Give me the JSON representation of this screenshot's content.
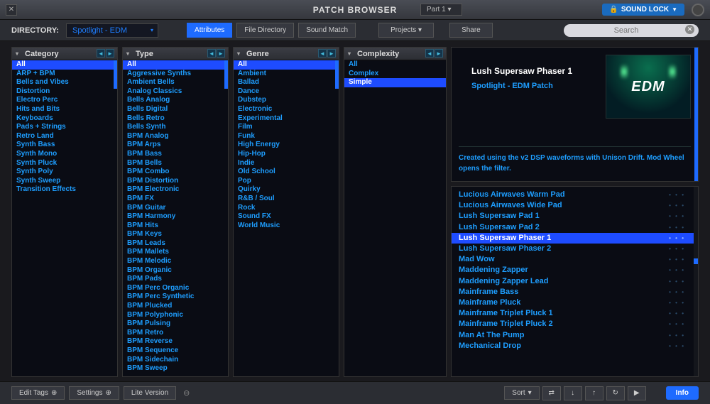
{
  "titlebar": {
    "title": "PATCH BROWSER",
    "part": "Part 1",
    "sound_lock": "SOUND LOCK"
  },
  "toolbar": {
    "directory_label": "DIRECTORY:",
    "directory_value": "Spotlight - EDM",
    "view_attributes": "Attributes",
    "view_file": "File Directory",
    "view_match": "Sound Match",
    "projects": "Projects",
    "share": "Share",
    "search_placeholder": "Search"
  },
  "columns": {
    "category": {
      "header": "Category",
      "items": [
        "All",
        "ARP + BPM",
        "Bells and Vibes",
        "Distortion",
        "Electro Perc",
        "Hits and Bits",
        "Keyboards",
        "Pads + Strings",
        "Retro Land",
        "Synth Bass",
        "Synth Mono",
        "Synth Pluck",
        "Synth Poly",
        "Synth Sweep",
        "Transition Effects"
      ],
      "selected": 0
    },
    "type": {
      "header": "Type",
      "items": [
        "All",
        "Aggressive Synths",
        "Ambient Bells",
        "Analog Classics",
        "Bells Analog",
        "Bells Digital",
        "Bells Retro",
        "Bells Synth",
        "BPM Analog",
        "BPM Arps",
        "BPM Bass",
        "BPM Bells",
        "BPM Combo",
        "BPM Distortion",
        "BPM Electronic",
        "BPM FX",
        "BPM Guitar",
        "BPM Harmony",
        "BPM Hits",
        "BPM Keys",
        "BPM Leads",
        "BPM Mallets",
        "BPM Melodic",
        "BPM Organic",
        "BPM Pads",
        "BPM Perc Organic",
        "BPM Perc Synthetic",
        "BPM Plucked",
        "BPM Polyphonic",
        "BPM Pulsing",
        "BPM Retro",
        "BPM Reverse",
        "BPM Sequence",
        "BPM Sidechain",
        "BPM Sweep"
      ],
      "selected": 0
    },
    "genre": {
      "header": "Genre",
      "items": [
        "All",
        "Ambient",
        "Ballad",
        "Dance",
        "Dubstep",
        "Electronic",
        "Experimental",
        "Film",
        "Funk",
        "High Energy",
        "Hip-Hop",
        "Indie",
        "Old School",
        "Pop",
        "Quirky",
        "R&B / Soul",
        "Rock",
        "Sound FX",
        "World Music"
      ],
      "selected": 0
    },
    "complexity": {
      "header": "Complexity",
      "items": [
        "All",
        "Complex",
        "Simple"
      ],
      "selected": 2
    }
  },
  "info": {
    "name": "Lush Supersaw Phaser 1",
    "dir": "Spotlight - EDM Patch",
    "art_label": "EDM",
    "desc": "Created using the v2 DSP waveforms with Unison Drift. Mod Wheel opens the filter."
  },
  "patch_list": {
    "items": [
      "Lucious Airwaves Warm Pad",
      "Lucious Airwaves Wide Pad",
      "Lush Supersaw Pad 1",
      "Lush Supersaw Pad 2",
      "Lush Supersaw Phaser 1",
      "Lush Supersaw Phaser 2",
      "Mad Wow",
      "Maddening Zapper",
      "Maddening Zapper Lead",
      "Mainframe Bass",
      "Mainframe Pluck",
      "Mainframe Triplet Pluck 1",
      "Mainframe Triplet Pluck 2",
      "Man At The Pump",
      "Mechanical Drop"
    ],
    "selected": 4
  },
  "footer": {
    "edit_tags": "Edit Tags",
    "settings": "Settings",
    "lite": "Lite Version",
    "sort": "Sort",
    "info": "Info"
  }
}
